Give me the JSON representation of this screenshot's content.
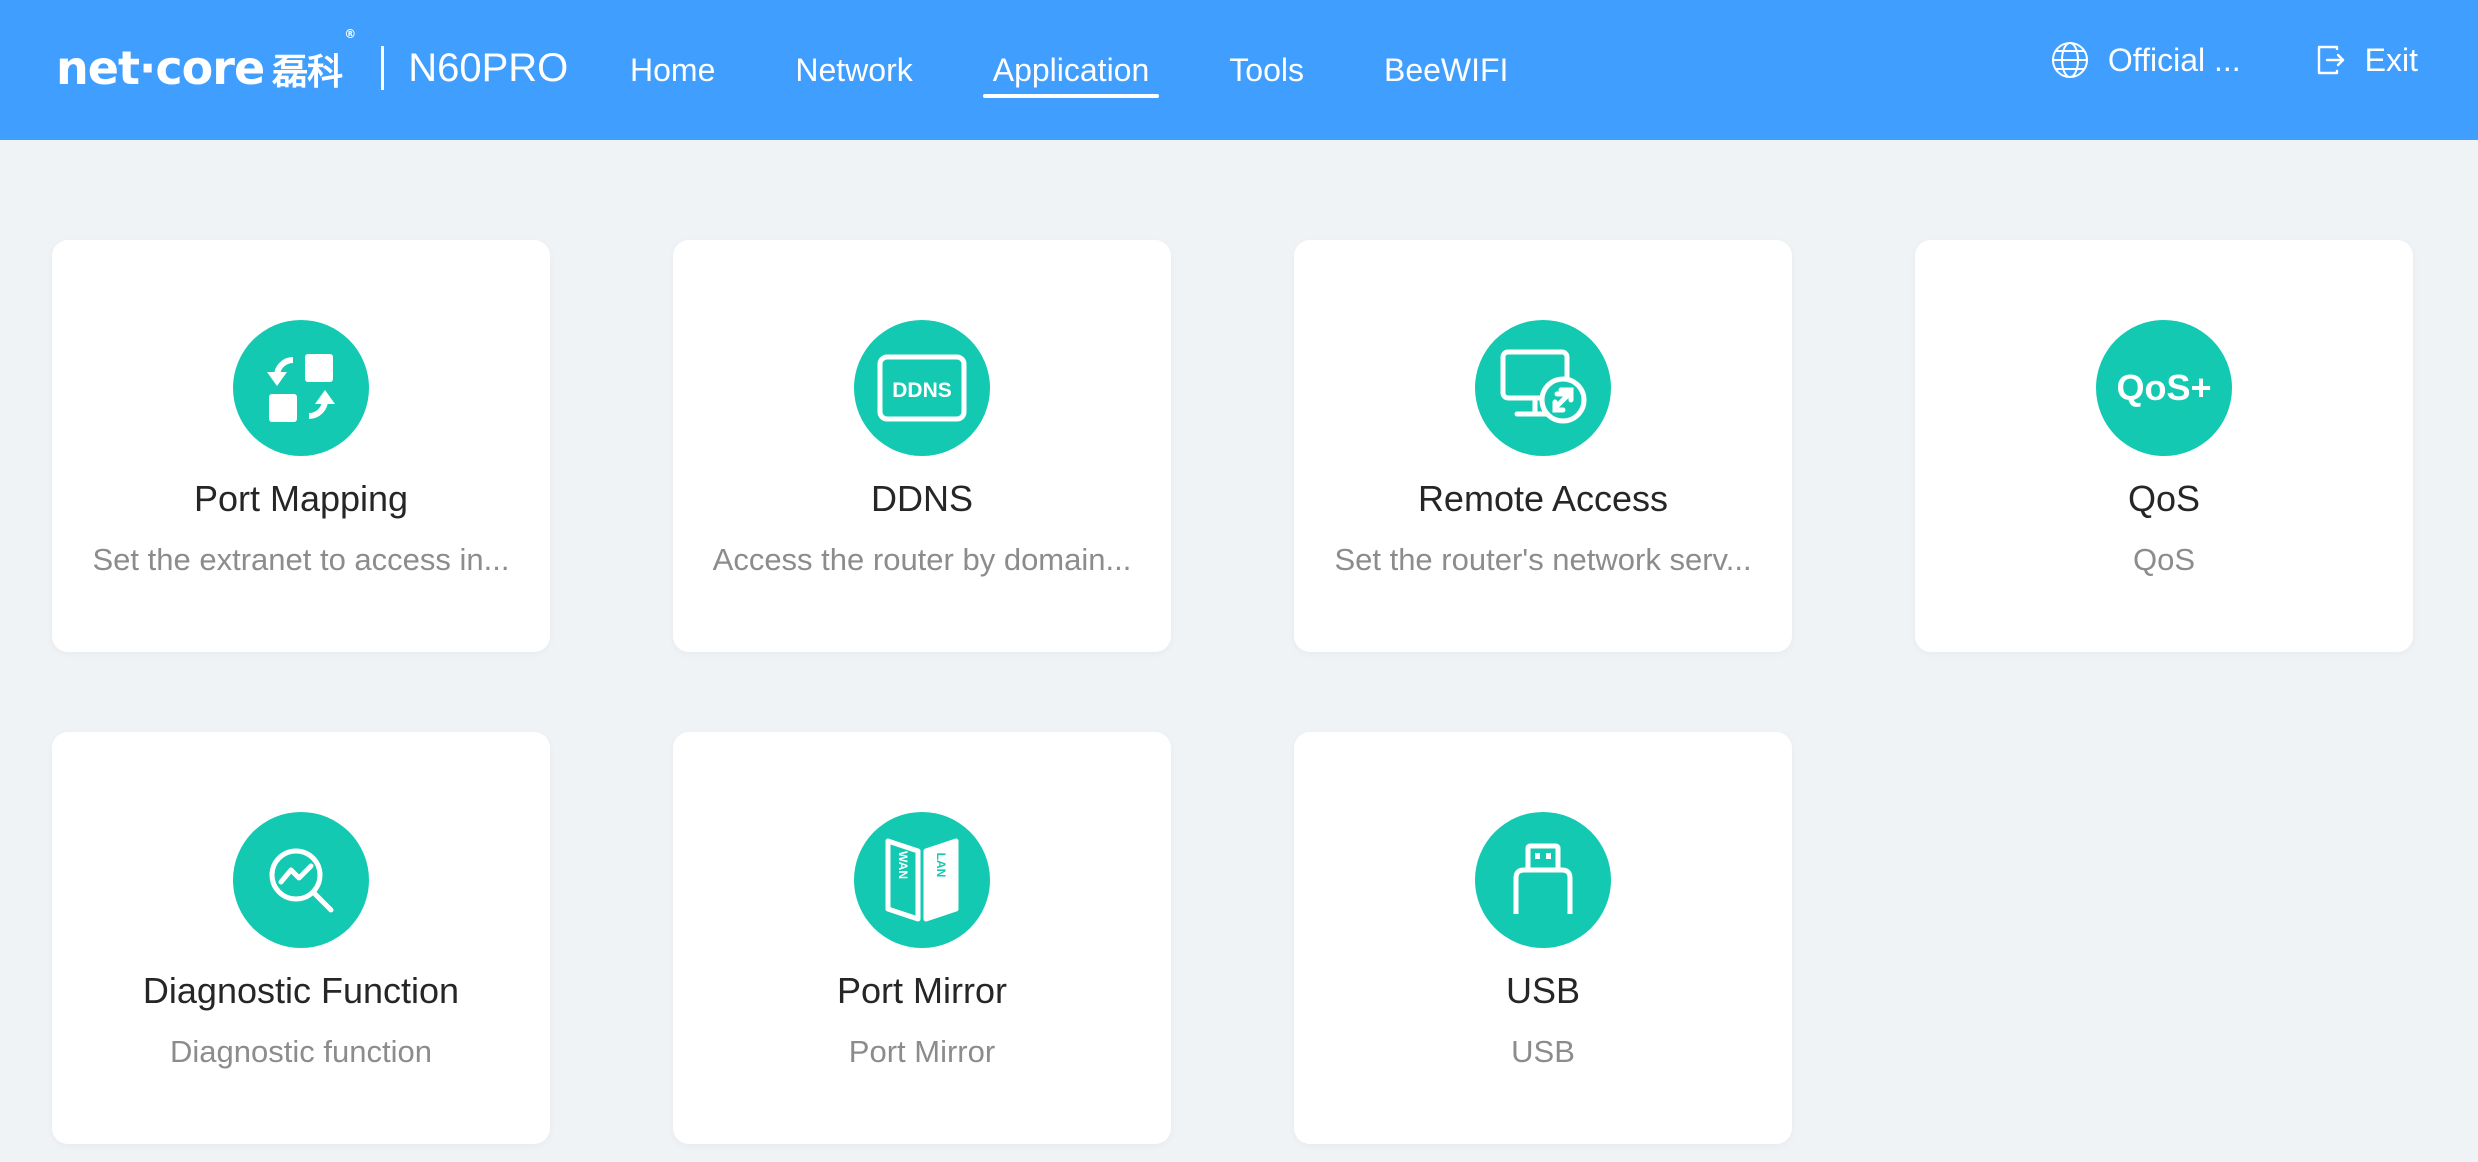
{
  "header": {
    "logo_text": "net·core",
    "logo_cn": "磊科",
    "logo_reg": "®",
    "model": "N60PRO",
    "nav": [
      {
        "label": "Home",
        "active": false
      },
      {
        "label": "Network",
        "active": false
      },
      {
        "label": "Application",
        "active": true
      },
      {
        "label": "Tools",
        "active": false
      },
      {
        "label": "BeeWIFI",
        "active": false
      }
    ],
    "language_label": "Official ...",
    "exit_label": "Exit"
  },
  "colors": {
    "header_bg": "#409eff",
    "page_bg": "#f0f3f6",
    "icon_bg": "#14c9b1",
    "title": "#262626",
    "desc": "#8c8c8c"
  },
  "cards": [
    {
      "title": "Port Mapping",
      "desc": "Set the extranet to access in...",
      "icon": "port-mapping-icon"
    },
    {
      "title": "DDNS",
      "desc": "Access the router by domain...",
      "icon": "ddns-icon",
      "icon_text": "DDNS"
    },
    {
      "title": "Remote Access",
      "desc": "Set the router's network serv...",
      "icon": "remote-access-icon"
    },
    {
      "title": "QoS",
      "desc": "QoS",
      "icon": "qos-icon",
      "icon_text": "QoS+"
    },
    {
      "title": "Diagnostic Function",
      "desc": "Diagnostic function",
      "icon": "diagnostic-icon"
    },
    {
      "title": "Port Mirror",
      "desc": "Port Mirror",
      "icon": "port-mirror-icon",
      "icon_text_left": "WAN",
      "icon_text_right": "LAN"
    },
    {
      "title": "USB",
      "desc": "USB",
      "icon": "usb-icon"
    }
  ]
}
